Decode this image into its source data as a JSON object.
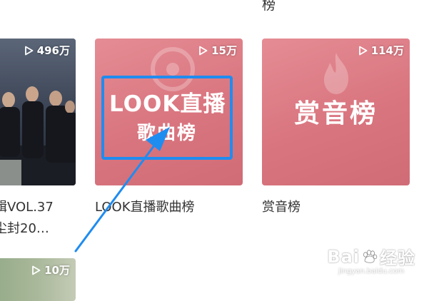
{
  "top_fragment": "榜",
  "cards": [
    {
      "id": "left",
      "plays": "496万",
      "caption_line1": "辑VOL.37",
      "caption_line2": "尘封20…"
    },
    {
      "id": "look",
      "plays": "15万",
      "cover_line1": "LOOK直播",
      "cover_line2": "歌曲榜",
      "caption": "LOOK直播歌曲榜"
    },
    {
      "id": "shang",
      "plays": "114万",
      "cover_title": "赏音榜",
      "caption": "赏音榜"
    },
    {
      "id": "bottom",
      "plays": "10万"
    }
  ],
  "watermark": {
    "main_left": "Bai",
    "main_right": "经验",
    "sub": "jingyan.baidu.com"
  },
  "colors": {
    "annotation": "#1f8cf0",
    "cover_pink": "#dd7d87"
  },
  "icons": [
    "play-icon",
    "paw-icon",
    "vinyl-icon",
    "flame-icon"
  ]
}
